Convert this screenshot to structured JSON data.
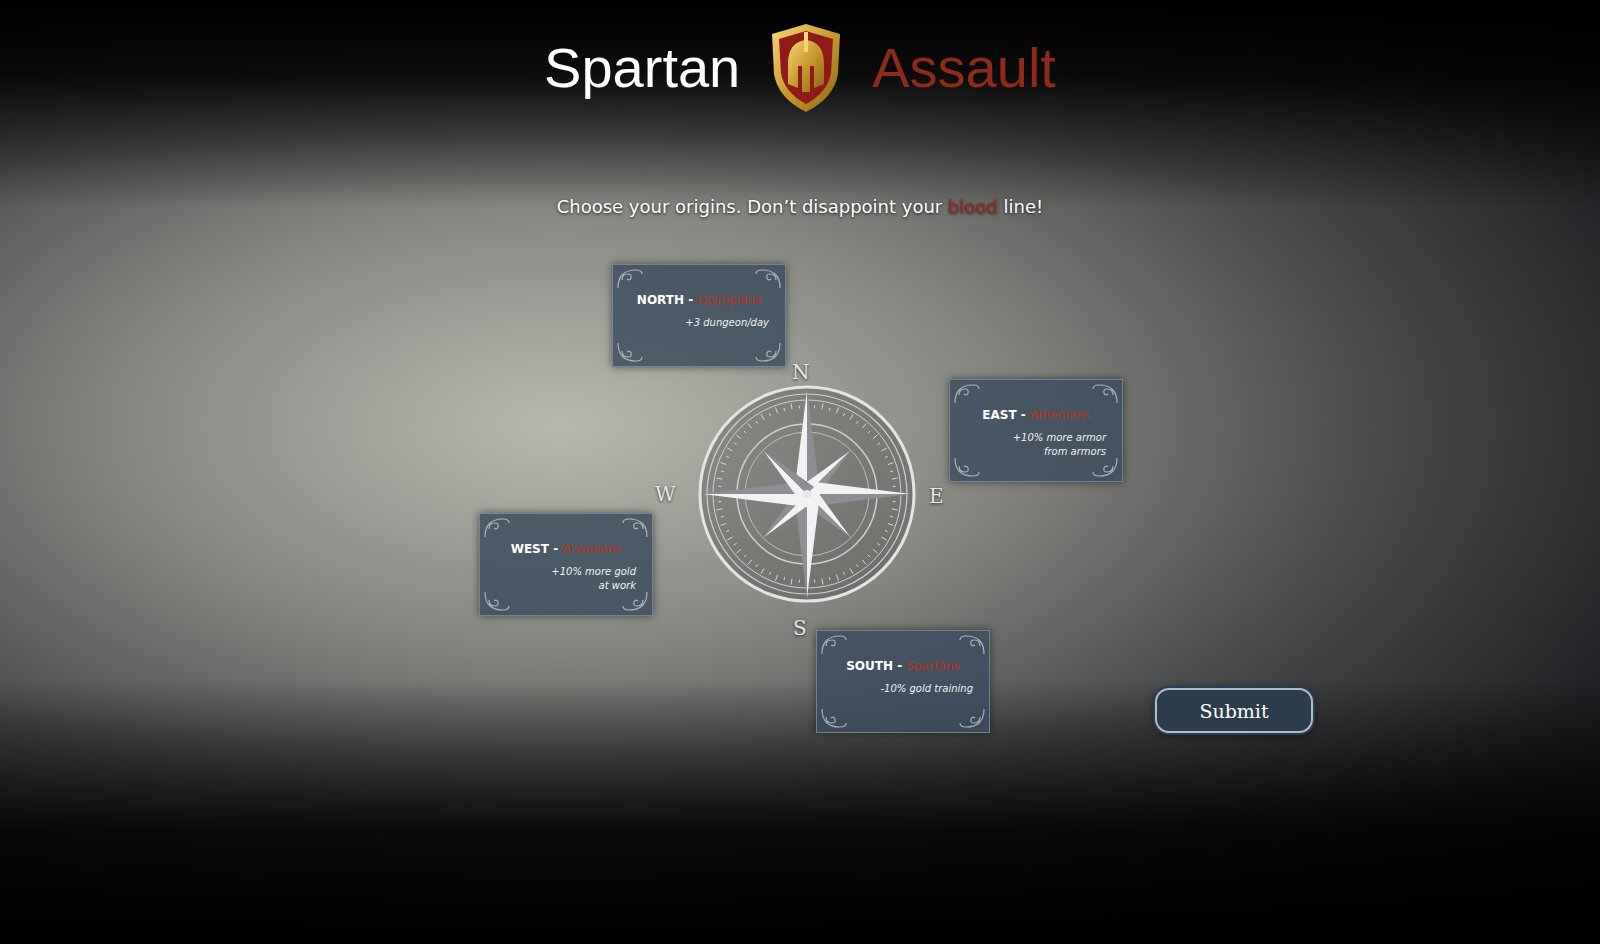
{
  "title": {
    "left": "Spartan",
    "right": "Assault"
  },
  "prompt": {
    "before": "Choose your origins. Don’t disappoint your ",
    "highlight": "blood",
    "after": " line!"
  },
  "separator": " - ",
  "origins": [
    {
      "direction": "NORTH",
      "name": "Olympians",
      "bonus": [
        "+3 dungeon/day"
      ],
      "selected": false
    },
    {
      "direction": "EAST",
      "name": "Athenians",
      "bonus": [
        "+10% more armor",
        "from armors"
      ],
      "selected": false
    },
    {
      "direction": "WEST",
      "name": "Arcadians",
      "bonus": [
        "+10% more gold",
        "at work"
      ],
      "selected": false
    },
    {
      "direction": "SOUTH",
      "name": "Spartans",
      "bonus": [
        "-10% gold training"
      ],
      "selected": false
    }
  ],
  "compass": [
    "N",
    "E",
    "W",
    "S"
  ],
  "submit": "Submit"
}
